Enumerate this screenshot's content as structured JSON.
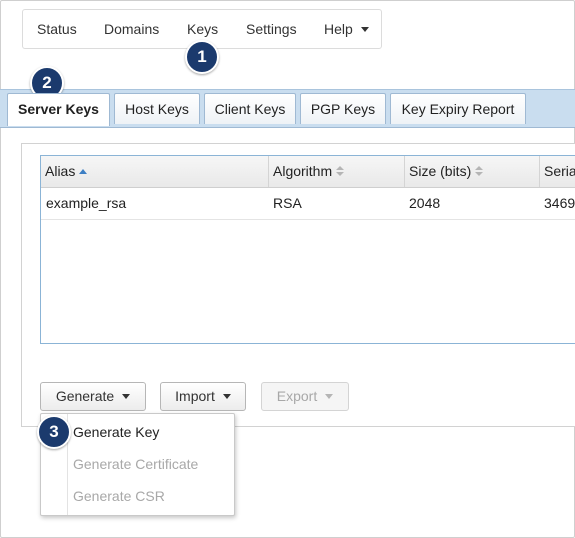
{
  "menu": {
    "items": [
      {
        "label": "Status"
      },
      {
        "label": "Domains"
      },
      {
        "label": "Keys"
      },
      {
        "label": "Settings"
      },
      {
        "label": "Help"
      }
    ]
  },
  "callouts": [
    "1",
    "2",
    "3"
  ],
  "tabs": [
    {
      "label": "Server Keys",
      "active": true
    },
    {
      "label": "Host Keys"
    },
    {
      "label": "Client Keys"
    },
    {
      "label": "PGP Keys"
    },
    {
      "label": "Key Expiry Report"
    }
  ],
  "table": {
    "columns": [
      "Alias",
      "Algorithm",
      "Size (bits)",
      "Seria"
    ],
    "rows": [
      [
        "example_rsa",
        "RSA",
        "2048",
        "3469"
      ]
    ]
  },
  "buttons": {
    "generate": "Generate",
    "import": "Import",
    "export": "Export"
  },
  "generate_menu": {
    "items": [
      {
        "label": "Generate Key",
        "enabled": true
      },
      {
        "label": "Generate Certificate",
        "enabled": false
      },
      {
        "label": "Generate CSR",
        "enabled": false
      }
    ]
  },
  "colors": {
    "tab_strip": "#c9ddef",
    "callout_badge": "#1b3a6d",
    "grid_border": "#8bb4d6",
    "sort_active": "#3d7fc4"
  }
}
